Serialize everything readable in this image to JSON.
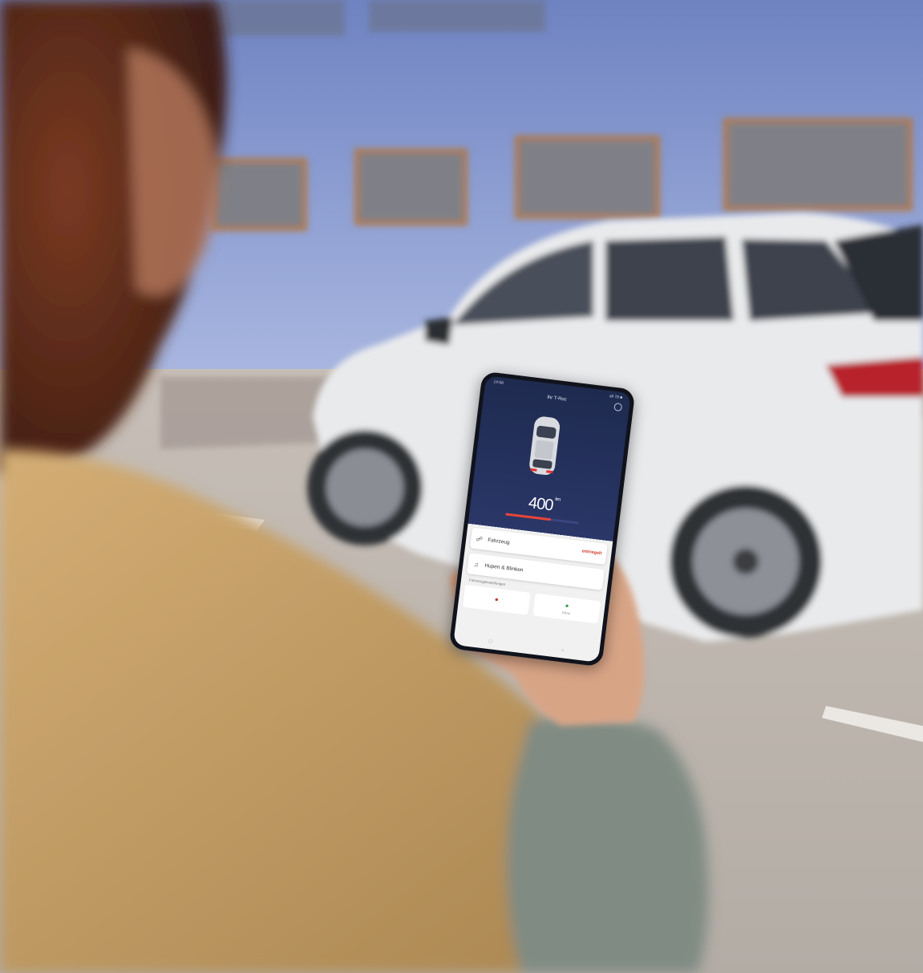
{
  "scene": {
    "description_colors": {
      "wall": "#8a9ed6",
      "window_frame": "#b07a4a",
      "car_body": "#e9eaec",
      "jacket": "#c9a26a",
      "asphalt": "#bdb7b0"
    }
  },
  "phone_app": {
    "status_time": "14:58",
    "status_right": "all 78 ■",
    "title": "Ihr T-Roc",
    "range_value": "400",
    "range_unit": "km",
    "range_fraction": 0.62,
    "lock_card": {
      "label": "Fahrzeug",
      "state": "entriegelt"
    },
    "horn_card": {
      "label": "Hupen & Blinken"
    },
    "section_label": "Fahrzeugeinstellungen",
    "tiles": [
      {
        "icon": "car-icon",
        "label": ""
      },
      {
        "icon": "seat-icon",
        "label": "Klima"
      }
    ],
    "nav_icons": [
      "home-icon",
      "car-icon",
      "menu-icon",
      "circle-icon"
    ]
  }
}
